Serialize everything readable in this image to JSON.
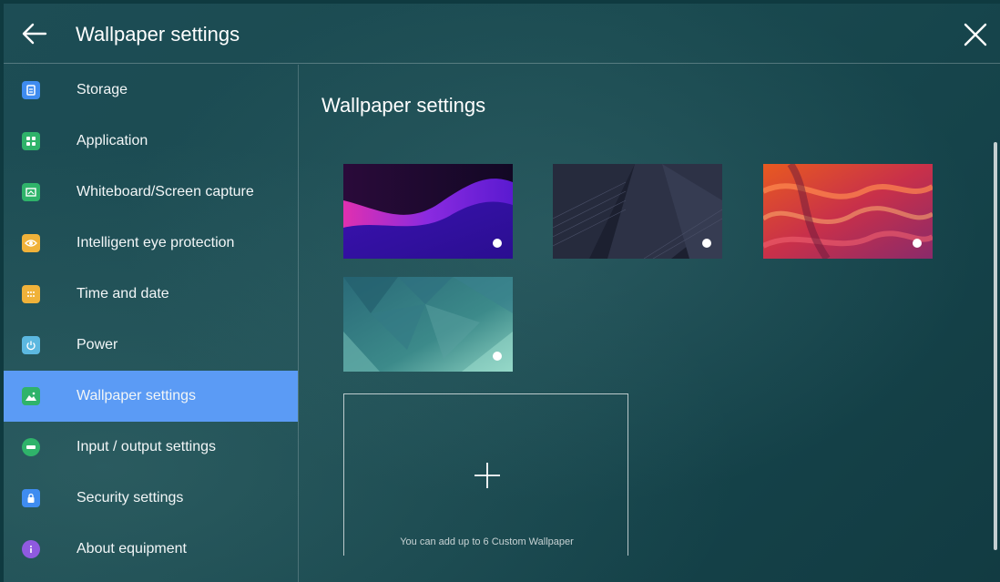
{
  "header": {
    "title": "Wallpaper settings"
  },
  "content": {
    "title": "Wallpaper settings",
    "add_hint": "You can add up to 6 Custom Wallpaper"
  },
  "sidebar": {
    "items": [
      {
        "label": "Storage",
        "icon": "storage-icon",
        "color": "#3f8cf0"
      },
      {
        "label": "Application",
        "icon": "application-icon",
        "color": "#2fb36a"
      },
      {
        "label": "Whiteboard/Screen capture",
        "icon": "whiteboard-icon",
        "color": "#2fb36a"
      },
      {
        "label": "Intelligent eye protection",
        "icon": "eye-icon",
        "color": "#f0b23a"
      },
      {
        "label": "Time and date",
        "icon": "calendar-icon",
        "color": "#f0b23a"
      },
      {
        "label": "Power",
        "icon": "power-icon",
        "color": "#5cb8e0"
      },
      {
        "label": "Wallpaper settings",
        "icon": "wallpaper-icon",
        "color": "#2fb36a",
        "active": true
      },
      {
        "label": "Input / output settings",
        "icon": "input-output-icon",
        "color": "#2fb36a"
      },
      {
        "label": "Security settings",
        "icon": "lock-icon",
        "color": "#3f8cf0"
      },
      {
        "label": "About equipment",
        "icon": "info-icon",
        "color": "#8f5ae0"
      }
    ]
  },
  "accent_color": "#5b9bf5"
}
